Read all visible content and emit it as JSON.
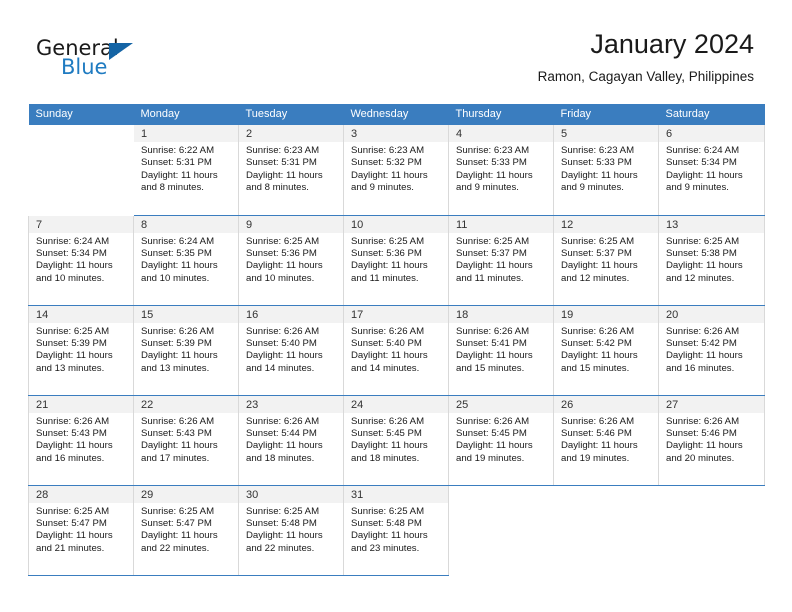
{
  "brand": {
    "word1": "General",
    "word2": "Blue",
    "triangle_color": "#1464a5",
    "blue_color": "#1f7bc1",
    "logo_icon": "general-blue-logo-icon"
  },
  "header": {
    "title": "January 2024",
    "subtitle": "Ramon, Cagayan Valley, Philippines"
  },
  "theme": {
    "header_row_bg": "#3a7dbf",
    "day_number_bg": "#f2f2f2",
    "cell_border": "#d9d9d9"
  },
  "calendar": {
    "weekday_headers": [
      "Sunday",
      "Monday",
      "Tuesday",
      "Wednesday",
      "Thursday",
      "Friday",
      "Saturday"
    ],
    "weeks": [
      [
        {
          "day": "",
          "sunrise": "",
          "sunset": "",
          "daylight": "",
          "empty": true
        },
        {
          "day": "1",
          "sunrise": "Sunrise: 6:22 AM",
          "sunset": "Sunset: 5:31 PM",
          "daylight": "Daylight: 11 hours and 8 minutes."
        },
        {
          "day": "2",
          "sunrise": "Sunrise: 6:23 AM",
          "sunset": "Sunset: 5:31 PM",
          "daylight": "Daylight: 11 hours and 8 minutes."
        },
        {
          "day": "3",
          "sunrise": "Sunrise: 6:23 AM",
          "sunset": "Sunset: 5:32 PM",
          "daylight": "Daylight: 11 hours and 9 minutes."
        },
        {
          "day": "4",
          "sunrise": "Sunrise: 6:23 AM",
          "sunset": "Sunset: 5:33 PM",
          "daylight": "Daylight: 11 hours and 9 minutes."
        },
        {
          "day": "5",
          "sunrise": "Sunrise: 6:23 AM",
          "sunset": "Sunset: 5:33 PM",
          "daylight": "Daylight: 11 hours and 9 minutes."
        },
        {
          "day": "6",
          "sunrise": "Sunrise: 6:24 AM",
          "sunset": "Sunset: 5:34 PM",
          "daylight": "Daylight: 11 hours and 9 minutes."
        }
      ],
      [
        {
          "day": "7",
          "sunrise": "Sunrise: 6:24 AM",
          "sunset": "Sunset: 5:34 PM",
          "daylight": "Daylight: 11 hours and 10 minutes."
        },
        {
          "day": "8",
          "sunrise": "Sunrise: 6:24 AM",
          "sunset": "Sunset: 5:35 PM",
          "daylight": "Daylight: 11 hours and 10 minutes."
        },
        {
          "day": "9",
          "sunrise": "Sunrise: 6:25 AM",
          "sunset": "Sunset: 5:36 PM",
          "daylight": "Daylight: 11 hours and 10 minutes."
        },
        {
          "day": "10",
          "sunrise": "Sunrise: 6:25 AM",
          "sunset": "Sunset: 5:36 PM",
          "daylight": "Daylight: 11 hours and 11 minutes."
        },
        {
          "day": "11",
          "sunrise": "Sunrise: 6:25 AM",
          "sunset": "Sunset: 5:37 PM",
          "daylight": "Daylight: 11 hours and 11 minutes."
        },
        {
          "day": "12",
          "sunrise": "Sunrise: 6:25 AM",
          "sunset": "Sunset: 5:37 PM",
          "daylight": "Daylight: 11 hours and 12 minutes."
        },
        {
          "day": "13",
          "sunrise": "Sunrise: 6:25 AM",
          "sunset": "Sunset: 5:38 PM",
          "daylight": "Daylight: 11 hours and 12 minutes."
        }
      ],
      [
        {
          "day": "14",
          "sunrise": "Sunrise: 6:25 AM",
          "sunset": "Sunset: 5:39 PM",
          "daylight": "Daylight: 11 hours and 13 minutes."
        },
        {
          "day": "15",
          "sunrise": "Sunrise: 6:26 AM",
          "sunset": "Sunset: 5:39 PM",
          "daylight": "Daylight: 11 hours and 13 minutes."
        },
        {
          "day": "16",
          "sunrise": "Sunrise: 6:26 AM",
          "sunset": "Sunset: 5:40 PM",
          "daylight": "Daylight: 11 hours and 14 minutes."
        },
        {
          "day": "17",
          "sunrise": "Sunrise: 6:26 AM",
          "sunset": "Sunset: 5:40 PM",
          "daylight": "Daylight: 11 hours and 14 minutes."
        },
        {
          "day": "18",
          "sunrise": "Sunrise: 6:26 AM",
          "sunset": "Sunset: 5:41 PM",
          "daylight": "Daylight: 11 hours and 15 minutes."
        },
        {
          "day": "19",
          "sunrise": "Sunrise: 6:26 AM",
          "sunset": "Sunset: 5:42 PM",
          "daylight": "Daylight: 11 hours and 15 minutes."
        },
        {
          "day": "20",
          "sunrise": "Sunrise: 6:26 AM",
          "sunset": "Sunset: 5:42 PM",
          "daylight": "Daylight: 11 hours and 16 minutes."
        }
      ],
      [
        {
          "day": "21",
          "sunrise": "Sunrise: 6:26 AM",
          "sunset": "Sunset: 5:43 PM",
          "daylight": "Daylight: 11 hours and 16 minutes."
        },
        {
          "day": "22",
          "sunrise": "Sunrise: 6:26 AM",
          "sunset": "Sunset: 5:43 PM",
          "daylight": "Daylight: 11 hours and 17 minutes."
        },
        {
          "day": "23",
          "sunrise": "Sunrise: 6:26 AM",
          "sunset": "Sunset: 5:44 PM",
          "daylight": "Daylight: 11 hours and 18 minutes."
        },
        {
          "day": "24",
          "sunrise": "Sunrise: 6:26 AM",
          "sunset": "Sunset: 5:45 PM",
          "daylight": "Daylight: 11 hours and 18 minutes."
        },
        {
          "day": "25",
          "sunrise": "Sunrise: 6:26 AM",
          "sunset": "Sunset: 5:45 PM",
          "daylight": "Daylight: 11 hours and 19 minutes."
        },
        {
          "day": "26",
          "sunrise": "Sunrise: 6:26 AM",
          "sunset": "Sunset: 5:46 PM",
          "daylight": "Daylight: 11 hours and 19 minutes."
        },
        {
          "day": "27",
          "sunrise": "Sunrise: 6:26 AM",
          "sunset": "Sunset: 5:46 PM",
          "daylight": "Daylight: 11 hours and 20 minutes."
        }
      ],
      [
        {
          "day": "28",
          "sunrise": "Sunrise: 6:25 AM",
          "sunset": "Sunset: 5:47 PM",
          "daylight": "Daylight: 11 hours and 21 minutes."
        },
        {
          "day": "29",
          "sunrise": "Sunrise: 6:25 AM",
          "sunset": "Sunset: 5:47 PM",
          "daylight": "Daylight: 11 hours and 22 minutes."
        },
        {
          "day": "30",
          "sunrise": "Sunrise: 6:25 AM",
          "sunset": "Sunset: 5:48 PM",
          "daylight": "Daylight: 11 hours and 22 minutes."
        },
        {
          "day": "31",
          "sunrise": "Sunrise: 6:25 AM",
          "sunset": "Sunset: 5:48 PM",
          "daylight": "Daylight: 11 hours and 23 minutes."
        },
        {
          "day": "",
          "sunrise": "",
          "sunset": "",
          "daylight": "",
          "empty": true
        },
        {
          "day": "",
          "sunrise": "",
          "sunset": "",
          "daylight": "",
          "empty": true
        },
        {
          "day": "",
          "sunrise": "",
          "sunset": "",
          "daylight": "",
          "empty": true
        }
      ]
    ]
  }
}
